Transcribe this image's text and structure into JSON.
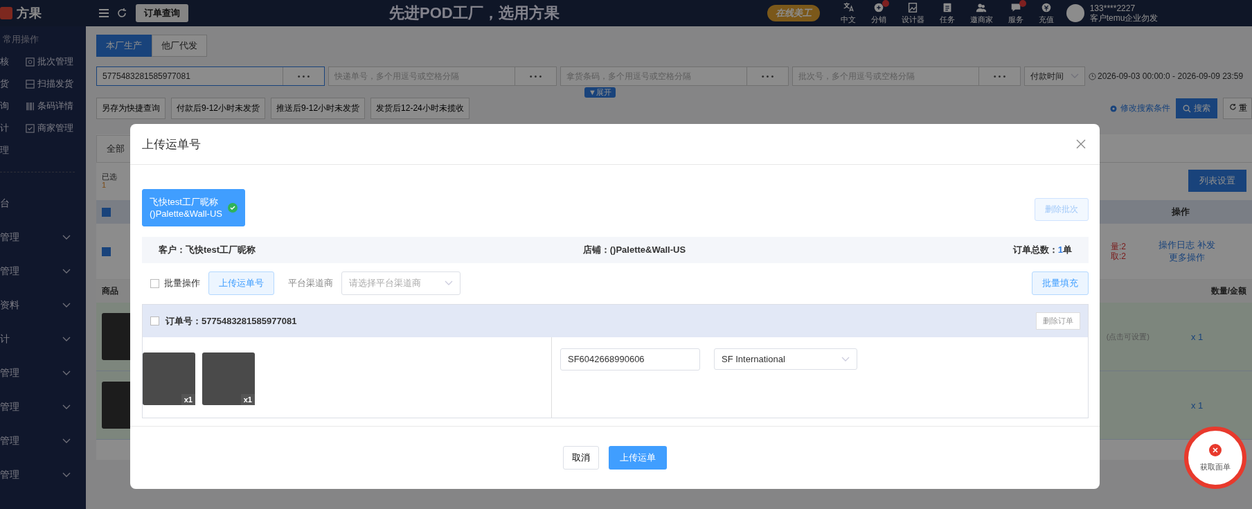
{
  "top_bar": {
    "logo": "方果",
    "page_tab": "订单查询",
    "banner": "先进POD工厂，选用方果",
    "promo": "在线美工",
    "icons": [
      {
        "kind": "translate",
        "label": "中文",
        "badge": false
      },
      {
        "kind": "share",
        "label": "分销",
        "badge": true
      },
      {
        "kind": "image",
        "label": "设计器",
        "badge": false
      },
      {
        "kind": "task",
        "label": "任务",
        "badge": false
      },
      {
        "kind": "people",
        "label": "邀商家",
        "badge": false
      },
      {
        "kind": "chat",
        "label": "服务",
        "badge": true
      },
      {
        "kind": "coin",
        "label": "充值",
        "badge": false
      }
    ],
    "user": {
      "phone": "133****2227",
      "account": "客户temu企业勿发"
    }
  },
  "sidebar": {
    "section": "常用操作",
    "quick_left": [
      "核",
      "货",
      "询",
      "计",
      "理"
    ],
    "quick_right": [
      {
        "kind": "box",
        "label": "批次管理"
      },
      {
        "kind": "scan",
        "label": "扫描发货"
      },
      {
        "kind": "barcode",
        "label": "条码详情"
      },
      {
        "kind": "check",
        "label": "商家管理"
      }
    ],
    "menu": [
      {
        "label": "台",
        "expandable": false
      },
      {
        "label": "管理",
        "expandable": true
      },
      {
        "label": "管理",
        "expandable": true
      },
      {
        "label": "资料",
        "expandable": true
      },
      {
        "label": "计",
        "expandable": true
      },
      {
        "label": "管理",
        "expandable": true
      },
      {
        "label": "管理",
        "expandable": true
      },
      {
        "label": "管理",
        "expandable": true
      },
      {
        "label": "管理",
        "expandable": true
      }
    ]
  },
  "page_tabs": [
    {
      "label": "本厂生产",
      "selected": true
    },
    {
      "label": "他厂代发",
      "selected": false
    }
  ],
  "filters": {
    "order_no": "5775483281585977081",
    "fields": [
      {
        "placeholder": "快递单号，多个用逗号或空格分隔"
      },
      {
        "placeholder": "拿货条码，多个用逗号或空格分隔"
      },
      {
        "placeholder": "批次号，多个用逗号或空格分隔"
      }
    ],
    "more_button": "• • •",
    "time_type": "付款时间",
    "date_start": "2026-09-03 00:00:0",
    "date_sep": "-",
    "date_end": "2026-09-09 23:59",
    "expand": "▼展开",
    "quick_queries": [
      "另存为快捷查询",
      "付款后9-12小时未发货",
      "推送后9-12小时未发货",
      "发货后12-24小时未揽收"
    ],
    "edit_conditions": "修改搜索条件",
    "search": "搜索",
    "reset": "重"
  },
  "list": {
    "status_tab": "全部",
    "selected_label": "已选",
    "selected_count": "1",
    "settings_button": "列表设置",
    "action_header": "操作",
    "header_checked": true,
    "row": {
      "checked": true,
      "stats": [
        "量:2",
        "取:2"
      ],
      "actions": [
        "操作日志",
        "补发"
      ],
      "more": "更多操作"
    },
    "goods_header": "商品",
    "qty_header": "数量/金额",
    "hint": "(点击可设置)",
    "quantities": [
      "x 1",
      "x 1"
    ]
  },
  "modal": {
    "title": "上传运单号",
    "batches": [
      {
        "name": "飞快test工厂昵称",
        "store": "()Palette&Wall-US",
        "selected": true
      }
    ],
    "delete_batch": {
      "label": "删除批次",
      "disabled": true
    },
    "info": {
      "customer_label": "客户：",
      "customer": "飞快test工厂昵称",
      "store_label": "店铺：",
      "store": "()Palette&Wall-US",
      "total_label": "订单总数：",
      "total": "1",
      "total_unit": "单"
    },
    "batch_ops": {
      "label": "批量操作",
      "checked": false
    },
    "upload_button": "上传运单号",
    "channel_label": "平台渠道商",
    "channel_placeholder": "请选择平台渠道商",
    "fill_button": "批量填充",
    "orders": [
      {
        "checked": false,
        "label": "订单号：",
        "number": "5775483281585977081",
        "delete": "删除订单",
        "images": [
          {
            "qty": "x1"
          },
          {
            "qty": "x1"
          }
        ],
        "tracking": "SF6042668990606",
        "carrier": "SF International"
      }
    ],
    "cancel": "取消",
    "submit": "上传运单"
  },
  "float_button": "获取面单"
}
